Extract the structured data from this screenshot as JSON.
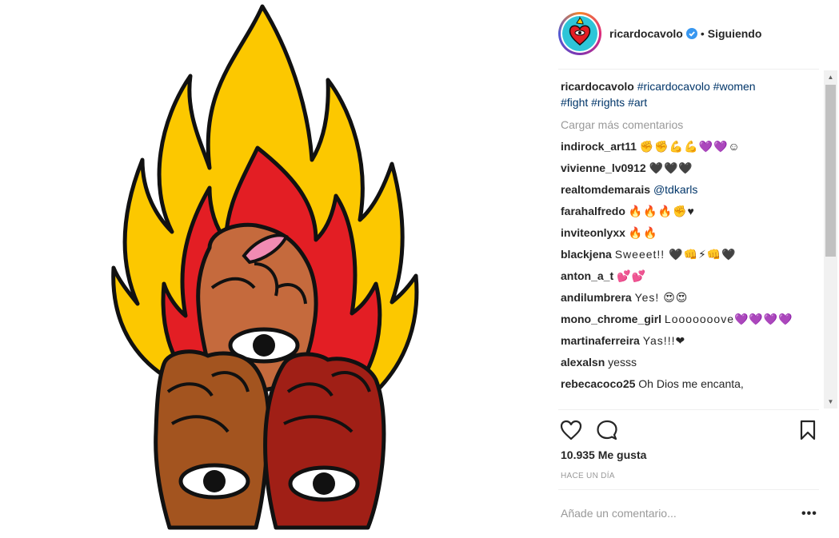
{
  "post": {
    "username": "ricardocavolo",
    "follow_status": "Siguiendo",
    "separator": "•",
    "caption_user": "ricardocavolo",
    "caption_tags": [
      "#ricardocavolo",
      "#women",
      "#fight",
      "#rights",
      "#art"
    ],
    "load_more": "Cargar más comentarios",
    "likes": "10.935 Me gusta",
    "time": "HACE UN DÍA",
    "add_comment_placeholder": "Añade un comentario...",
    "more_options": "•••"
  },
  "comments": [
    {
      "user": "indirock_art11",
      "text": "✊✊💪💪💜💜☺"
    },
    {
      "user": "vivienne_lv0912",
      "text": "🖤🖤🖤"
    },
    {
      "user": "realtomdemarais",
      "text": "@tdkarls"
    },
    {
      "user": "farahalfredo",
      "text": "🔥🔥🔥✊♥"
    },
    {
      "user": "inviteonlyxx",
      "text": "🔥🔥"
    },
    {
      "user": "blackjena",
      "text": "Sweeet!! 🖤👊⚡👊🖤"
    },
    {
      "user": "anton_a_t",
      "text": "💕💕"
    },
    {
      "user": "andilumbrera",
      "text": "Yes! 😍😍"
    },
    {
      "user": "mono_chrome_girl",
      "text": "Looooooove💜💜💜💜"
    },
    {
      "user": "martinaferreira",
      "text": "Yas!!!❤"
    },
    {
      "user": "alexalsn",
      "text": "yesss"
    },
    {
      "user": "rebecacoco25",
      "text": "Oh Dios me encanta,"
    }
  ],
  "icons": {
    "like": "heart-outline-icon",
    "comment": "speech-bubble-icon",
    "save": "bookmark-icon",
    "verified": "verified-badge-icon"
  },
  "colors": {
    "flame_yellow": "#fcc800",
    "flame_red": "#e31e24",
    "verified_blue": "#3897f0",
    "hashtag": "#003569"
  }
}
